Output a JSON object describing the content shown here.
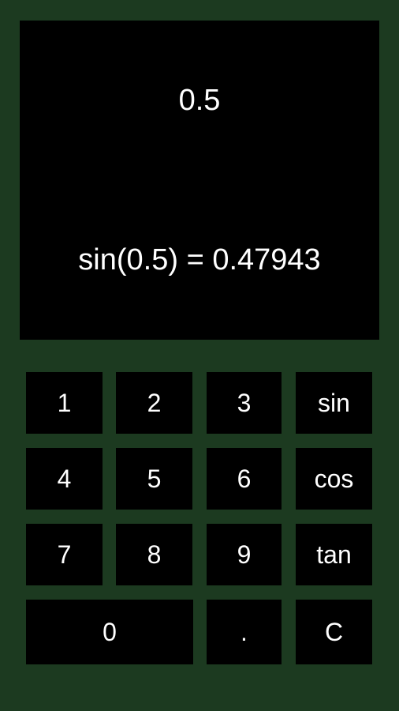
{
  "theme": {
    "background": "#1c3a20",
    "panel_background": "#000000",
    "text_color": "#ffffff"
  },
  "display": {
    "entry_value": "0.5",
    "result_text": "sin(0.5) = 0.47943"
  },
  "keypad": {
    "keys": [
      {
        "label": "1",
        "name": "key-1",
        "col": "col0",
        "row": "row0"
      },
      {
        "label": "2",
        "name": "key-2",
        "col": "col1",
        "row": "row0"
      },
      {
        "label": "3",
        "name": "key-3",
        "col": "col2",
        "row": "row0"
      },
      {
        "label": "sin",
        "name": "key-sin",
        "col": "col3",
        "row": "row0"
      },
      {
        "label": "4",
        "name": "key-4",
        "col": "col0",
        "row": "row1"
      },
      {
        "label": "5",
        "name": "key-5",
        "col": "col1",
        "row": "row1"
      },
      {
        "label": "6",
        "name": "key-6",
        "col": "col2",
        "row": "row1"
      },
      {
        "label": "cos",
        "name": "key-cos",
        "col": "col3",
        "row": "row1"
      },
      {
        "label": "7",
        "name": "key-7",
        "col": "col0",
        "row": "row2"
      },
      {
        "label": "8",
        "name": "key-8",
        "col": "col1",
        "row": "row2"
      },
      {
        "label": "9",
        "name": "key-9",
        "col": "col2",
        "row": "row2"
      },
      {
        "label": "tan",
        "name": "key-tan",
        "col": "col3",
        "row": "row2"
      },
      {
        "label": "0",
        "name": "key-0",
        "col": "col0-wide",
        "row": "row3"
      },
      {
        "label": ".",
        "name": "key-decimal-point",
        "col": "col2",
        "row": "row3"
      },
      {
        "label": "C",
        "name": "key-clear",
        "col": "col3",
        "row": "row3"
      }
    ]
  }
}
